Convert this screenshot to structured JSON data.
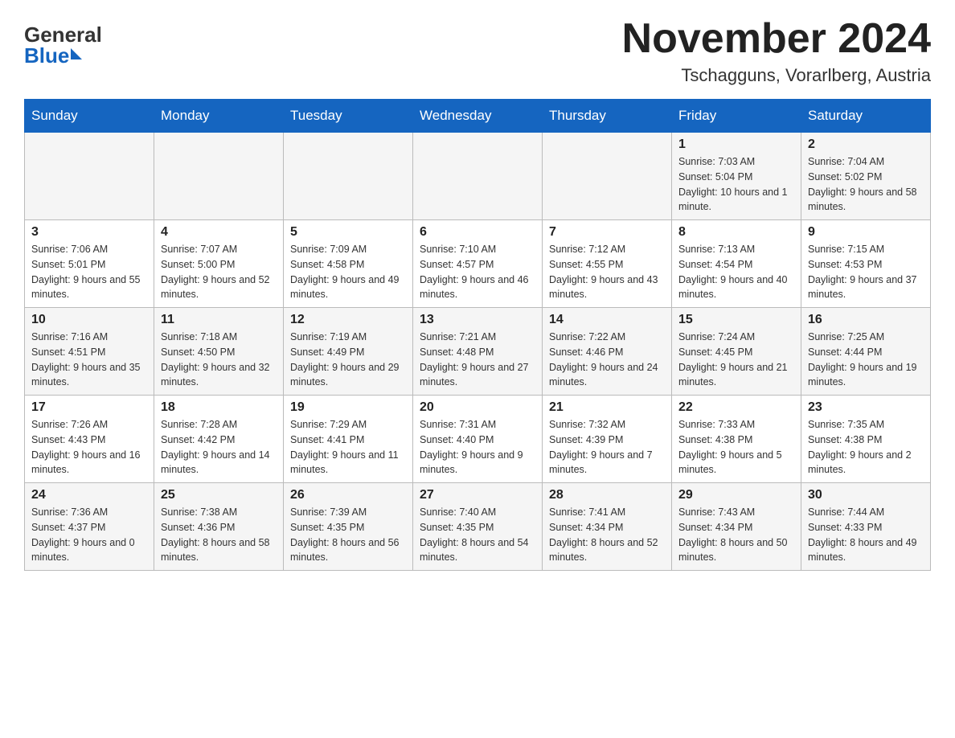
{
  "header": {
    "logo_general": "General",
    "logo_blue": "Blue",
    "month": "November 2024",
    "location": "Tschagguns, Vorarlberg, Austria"
  },
  "days_of_week": [
    "Sunday",
    "Monday",
    "Tuesday",
    "Wednesday",
    "Thursday",
    "Friday",
    "Saturday"
  ],
  "weeks": [
    [
      {
        "day": "",
        "sunrise": "",
        "sunset": "",
        "daylight": ""
      },
      {
        "day": "",
        "sunrise": "",
        "sunset": "",
        "daylight": ""
      },
      {
        "day": "",
        "sunrise": "",
        "sunset": "",
        "daylight": ""
      },
      {
        "day": "",
        "sunrise": "",
        "sunset": "",
        "daylight": ""
      },
      {
        "day": "",
        "sunrise": "",
        "sunset": "",
        "daylight": ""
      },
      {
        "day": "1",
        "sunrise": "Sunrise: 7:03 AM",
        "sunset": "Sunset: 5:04 PM",
        "daylight": "Daylight: 10 hours and 1 minute."
      },
      {
        "day": "2",
        "sunrise": "Sunrise: 7:04 AM",
        "sunset": "Sunset: 5:02 PM",
        "daylight": "Daylight: 9 hours and 58 minutes."
      }
    ],
    [
      {
        "day": "3",
        "sunrise": "Sunrise: 7:06 AM",
        "sunset": "Sunset: 5:01 PM",
        "daylight": "Daylight: 9 hours and 55 minutes."
      },
      {
        "day": "4",
        "sunrise": "Sunrise: 7:07 AM",
        "sunset": "Sunset: 5:00 PM",
        "daylight": "Daylight: 9 hours and 52 minutes."
      },
      {
        "day": "5",
        "sunrise": "Sunrise: 7:09 AM",
        "sunset": "Sunset: 4:58 PM",
        "daylight": "Daylight: 9 hours and 49 minutes."
      },
      {
        "day": "6",
        "sunrise": "Sunrise: 7:10 AM",
        "sunset": "Sunset: 4:57 PM",
        "daylight": "Daylight: 9 hours and 46 minutes."
      },
      {
        "day": "7",
        "sunrise": "Sunrise: 7:12 AM",
        "sunset": "Sunset: 4:55 PM",
        "daylight": "Daylight: 9 hours and 43 minutes."
      },
      {
        "day": "8",
        "sunrise": "Sunrise: 7:13 AM",
        "sunset": "Sunset: 4:54 PM",
        "daylight": "Daylight: 9 hours and 40 minutes."
      },
      {
        "day": "9",
        "sunrise": "Sunrise: 7:15 AM",
        "sunset": "Sunset: 4:53 PM",
        "daylight": "Daylight: 9 hours and 37 minutes."
      }
    ],
    [
      {
        "day": "10",
        "sunrise": "Sunrise: 7:16 AM",
        "sunset": "Sunset: 4:51 PM",
        "daylight": "Daylight: 9 hours and 35 minutes."
      },
      {
        "day": "11",
        "sunrise": "Sunrise: 7:18 AM",
        "sunset": "Sunset: 4:50 PM",
        "daylight": "Daylight: 9 hours and 32 minutes."
      },
      {
        "day": "12",
        "sunrise": "Sunrise: 7:19 AM",
        "sunset": "Sunset: 4:49 PM",
        "daylight": "Daylight: 9 hours and 29 minutes."
      },
      {
        "day": "13",
        "sunrise": "Sunrise: 7:21 AM",
        "sunset": "Sunset: 4:48 PM",
        "daylight": "Daylight: 9 hours and 27 minutes."
      },
      {
        "day": "14",
        "sunrise": "Sunrise: 7:22 AM",
        "sunset": "Sunset: 4:46 PM",
        "daylight": "Daylight: 9 hours and 24 minutes."
      },
      {
        "day": "15",
        "sunrise": "Sunrise: 7:24 AM",
        "sunset": "Sunset: 4:45 PM",
        "daylight": "Daylight: 9 hours and 21 minutes."
      },
      {
        "day": "16",
        "sunrise": "Sunrise: 7:25 AM",
        "sunset": "Sunset: 4:44 PM",
        "daylight": "Daylight: 9 hours and 19 minutes."
      }
    ],
    [
      {
        "day": "17",
        "sunrise": "Sunrise: 7:26 AM",
        "sunset": "Sunset: 4:43 PM",
        "daylight": "Daylight: 9 hours and 16 minutes."
      },
      {
        "day": "18",
        "sunrise": "Sunrise: 7:28 AM",
        "sunset": "Sunset: 4:42 PM",
        "daylight": "Daylight: 9 hours and 14 minutes."
      },
      {
        "day": "19",
        "sunrise": "Sunrise: 7:29 AM",
        "sunset": "Sunset: 4:41 PM",
        "daylight": "Daylight: 9 hours and 11 minutes."
      },
      {
        "day": "20",
        "sunrise": "Sunrise: 7:31 AM",
        "sunset": "Sunset: 4:40 PM",
        "daylight": "Daylight: 9 hours and 9 minutes."
      },
      {
        "day": "21",
        "sunrise": "Sunrise: 7:32 AM",
        "sunset": "Sunset: 4:39 PM",
        "daylight": "Daylight: 9 hours and 7 minutes."
      },
      {
        "day": "22",
        "sunrise": "Sunrise: 7:33 AM",
        "sunset": "Sunset: 4:38 PM",
        "daylight": "Daylight: 9 hours and 5 minutes."
      },
      {
        "day": "23",
        "sunrise": "Sunrise: 7:35 AM",
        "sunset": "Sunset: 4:38 PM",
        "daylight": "Daylight: 9 hours and 2 minutes."
      }
    ],
    [
      {
        "day": "24",
        "sunrise": "Sunrise: 7:36 AM",
        "sunset": "Sunset: 4:37 PM",
        "daylight": "Daylight: 9 hours and 0 minutes."
      },
      {
        "day": "25",
        "sunrise": "Sunrise: 7:38 AM",
        "sunset": "Sunset: 4:36 PM",
        "daylight": "Daylight: 8 hours and 58 minutes."
      },
      {
        "day": "26",
        "sunrise": "Sunrise: 7:39 AM",
        "sunset": "Sunset: 4:35 PM",
        "daylight": "Daylight: 8 hours and 56 minutes."
      },
      {
        "day": "27",
        "sunrise": "Sunrise: 7:40 AM",
        "sunset": "Sunset: 4:35 PM",
        "daylight": "Daylight: 8 hours and 54 minutes."
      },
      {
        "day": "28",
        "sunrise": "Sunrise: 7:41 AM",
        "sunset": "Sunset: 4:34 PM",
        "daylight": "Daylight: 8 hours and 52 minutes."
      },
      {
        "day": "29",
        "sunrise": "Sunrise: 7:43 AM",
        "sunset": "Sunset: 4:34 PM",
        "daylight": "Daylight: 8 hours and 50 minutes."
      },
      {
        "day": "30",
        "sunrise": "Sunrise: 7:44 AM",
        "sunset": "Sunset: 4:33 PM",
        "daylight": "Daylight: 8 hours and 49 minutes."
      }
    ]
  ]
}
